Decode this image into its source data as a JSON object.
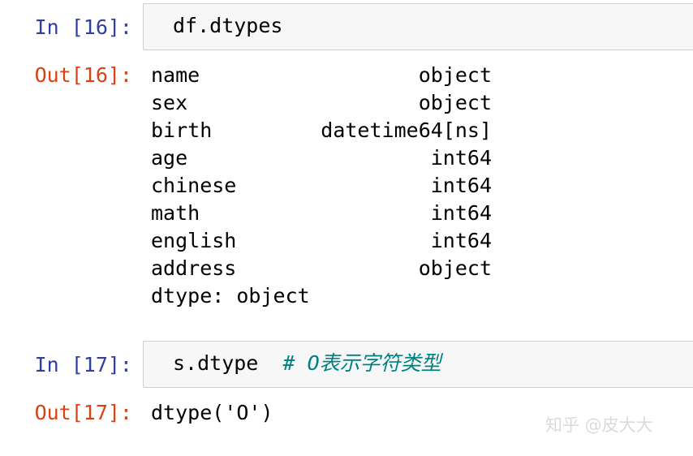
{
  "cells": [
    {
      "in_prompt": "In [16]:",
      "code": "df.dtypes",
      "out_prompt": "Out[16]:",
      "output_rows": [
        {
          "name": "name",
          "type": "object"
        },
        {
          "name": "sex",
          "type": "object"
        },
        {
          "name": "birth",
          "type": "datetime64[ns]"
        },
        {
          "name": "age",
          "type": "int64"
        },
        {
          "name": "chinese",
          "type": "int64"
        },
        {
          "name": "math",
          "type": "int64"
        },
        {
          "name": "english",
          "type": "int64"
        },
        {
          "name": "address",
          "type": "object"
        }
      ],
      "output_footer": "dtype: object"
    },
    {
      "in_prompt": "In [17]:",
      "code": "s.dtype",
      "comment": "# O表示字符类型",
      "out_prompt": "Out[17]:",
      "output_text": "dtype('O')"
    }
  ],
  "watermark": "知乎 @皮大大",
  "colors": {
    "in_prompt": "#303f9f",
    "out_prompt": "#d84315",
    "comment": "#008080",
    "input_bg": "#f7f7f7",
    "input_border": "#cfcfcf"
  }
}
